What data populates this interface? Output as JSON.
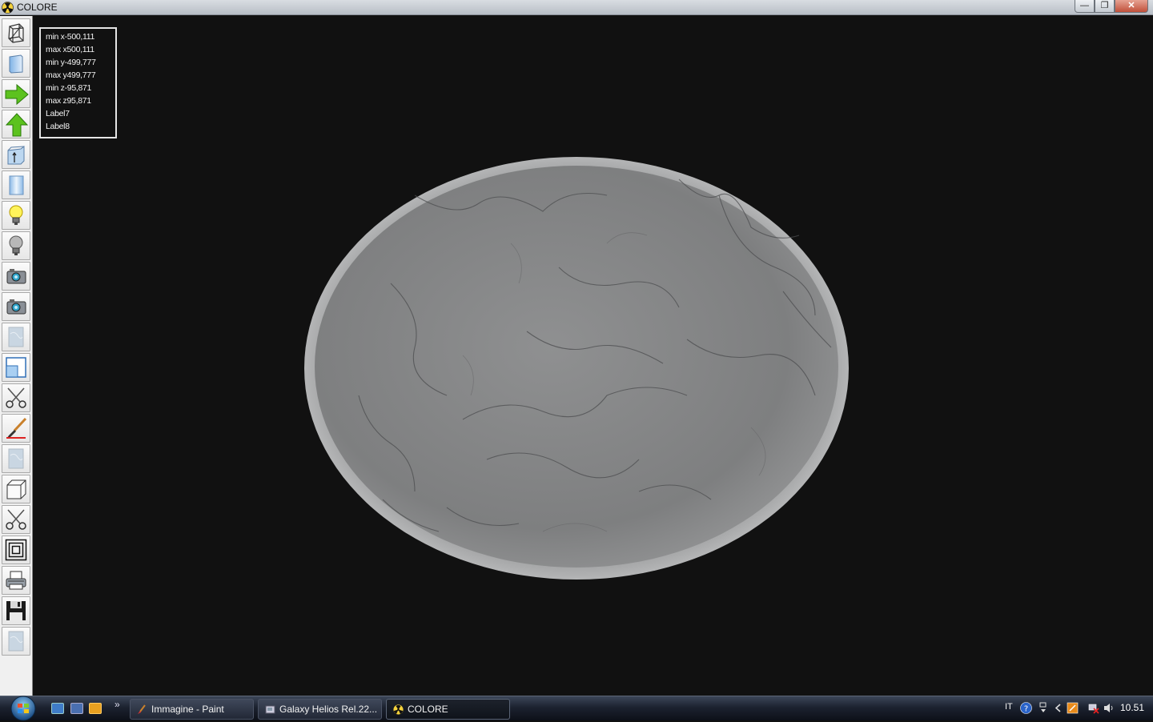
{
  "window": {
    "title": "COLORE",
    "min_label": "—",
    "restore_label": "❐",
    "close_label": "✕"
  },
  "toolbar": {
    "tools": [
      {
        "icon": "wireframe-box-icon"
      },
      {
        "icon": "solid-panel-icon"
      },
      {
        "icon": "green-arrow-right-icon"
      },
      {
        "icon": "green-arrow-up-icon"
      },
      {
        "icon": "extrude-box-icon"
      },
      {
        "icon": "cylinder-icon"
      },
      {
        "icon": "light-bulb-on-icon"
      },
      {
        "icon": "light-bulb-off-icon"
      },
      {
        "icon": "camera-icon"
      },
      {
        "icon": "camera-icon"
      },
      {
        "icon": "texture-disabled-icon"
      },
      {
        "icon": "window-split-icon"
      },
      {
        "icon": "scissors-icon"
      },
      {
        "icon": "paint-brush-icon"
      },
      {
        "icon": "texture-disabled-icon"
      },
      {
        "icon": "cube-icon"
      },
      {
        "icon": "scissors-icon"
      },
      {
        "icon": "concentric-squares-icon"
      },
      {
        "icon": "printer-icon"
      },
      {
        "icon": "floppy-disk-icon"
      },
      {
        "icon": "texture-disabled-icon"
      }
    ]
  },
  "info": {
    "lines": [
      "min x-500,111",
      "max x500,111",
      "min y-499,777",
      "max y499,777",
      "min z-95,871",
      "max z95,871",
      "Label7",
      "Label8"
    ]
  },
  "taskbar": {
    "more_label": "»",
    "tasks": [
      {
        "label": "Immagine - Paint"
      },
      {
        "label": "Galaxy Helios  Rel.22..."
      },
      {
        "label": "COLORE"
      }
    ],
    "language": "IT",
    "clock": "10.51"
  }
}
